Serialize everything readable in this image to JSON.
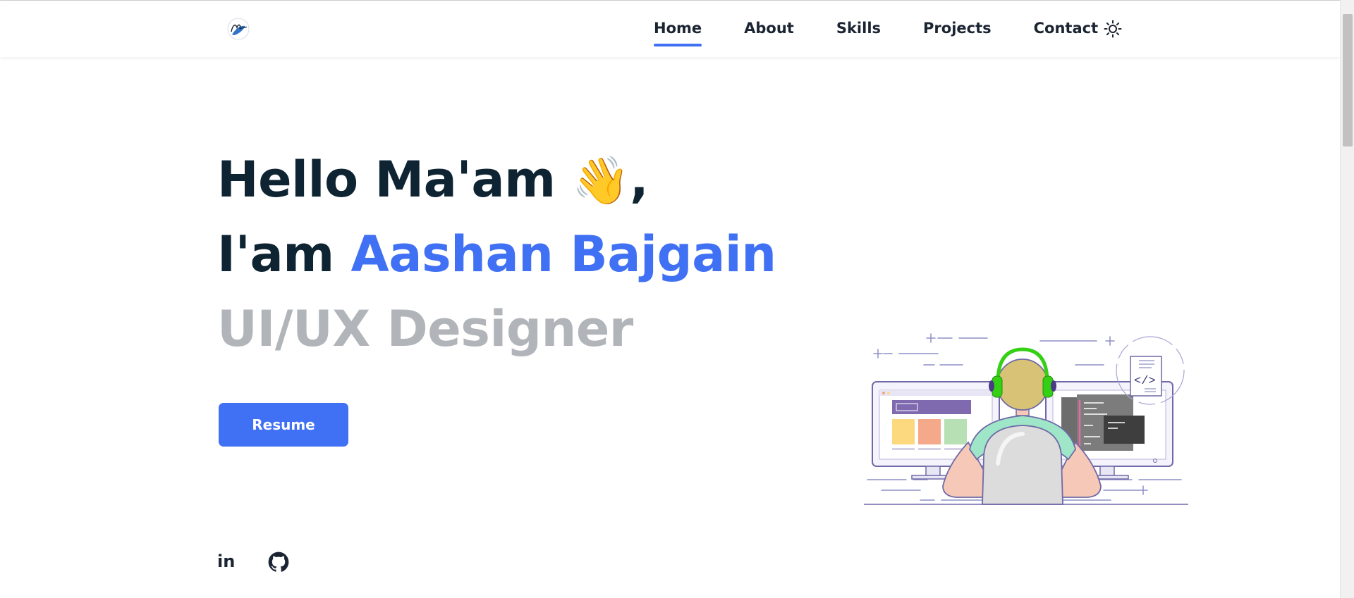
{
  "nav": {
    "logo_alt": "Aashan logo",
    "links": [
      {
        "label": "Home",
        "active": true
      },
      {
        "label": "About"
      },
      {
        "label": "Skills"
      },
      {
        "label": "Projects"
      },
      {
        "label": "Contact"
      }
    ],
    "theme_icon": "sun-icon"
  },
  "hero": {
    "greeting": "Hello Ma'am",
    "wave_emoji": "👋",
    "greeting_comma": ",",
    "iam": "I'am",
    "name": "Aashan Bajgain",
    "role": "UI/UX Designer",
    "resume_label": "Resume"
  },
  "social": {
    "linkedin_label": "in",
    "linkedin_icon": "linkedin-icon",
    "github_icon": "github-icon"
  },
  "colors": {
    "accent": "#4070f4",
    "heading": "#0f2432",
    "muted": "#b1b5b9"
  }
}
